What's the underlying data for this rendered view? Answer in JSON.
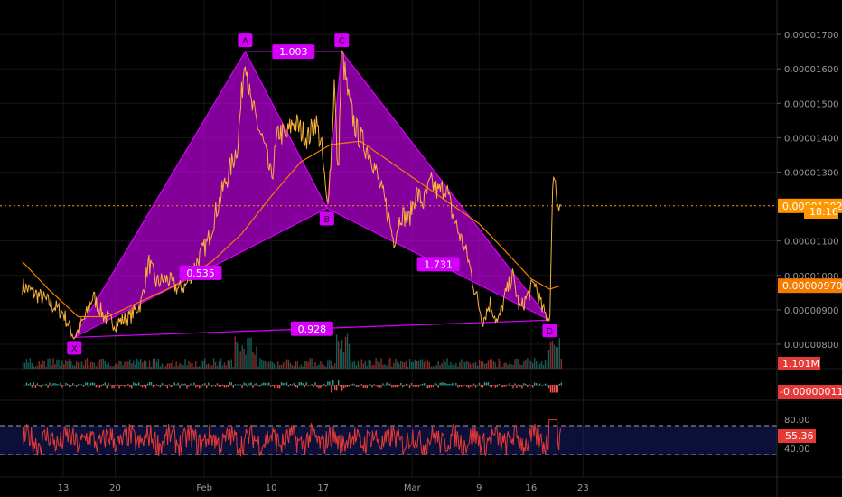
{
  "chart_data": {
    "type": "line",
    "title": "",
    "price_axis": {
      "ylim": [
        7.5e-06,
        1.8e-05
      ],
      "ticks": [
        "0.00001700",
        "0.00001600",
        "0.00001500",
        "0.00001400",
        "0.00001300",
        "0.00001100",
        "0.00001000",
        "0.00000900",
        "0.00000800"
      ],
      "tick_values": [
        1.7e-05,
        1.6e-05,
        1.5e-05,
        1.4e-05,
        1.3e-05,
        1.1e-05,
        1e-05,
        9e-06,
        8e-06
      ]
    },
    "date_axis": {
      "labels": [
        "13",
        "20",
        "Feb",
        "10",
        "17",
        "Mar",
        "9",
        "16",
        "23"
      ],
      "day_index": [
        0,
        7,
        19,
        28,
        35,
        47,
        56,
        63,
        70
      ]
    },
    "current_price": {
      "value": "0.00001202",
      "countdown": "18:16",
      "color": "#ff9800"
    },
    "moving_average": {
      "value": "0.00000970",
      "color": "#f57c00"
    },
    "volume": {
      "value": "1.101M",
      "color": "#e53935"
    },
    "macd": {
      "value": "-0.00000011",
      "color": "#e53935"
    },
    "rsi": {
      "value": "55.36",
      "upper": "80.00",
      "lower": "40.00",
      "upper_value": 70,
      "lower_value": 30,
      "color": "#e53935"
    },
    "harmonic_pattern": {
      "color": "#d500f9",
      "points": [
        {
          "name": "X",
          "day": 1.5,
          "price": 8.2e-06
        },
        {
          "name": "A",
          "day": 24.5,
          "price": 1.65e-05
        },
        {
          "name": "B",
          "day": 35.5,
          "price": 1.195e-05
        },
        {
          "name": "C",
          "day": 37.5,
          "price": 1.65e-05
        },
        {
          "name": "D",
          "day": 65.5,
          "price": 8.7e-06
        }
      ],
      "ratios": [
        {
          "label": "0.535",
          "between": "XB"
        },
        {
          "label": "1.003",
          "between": "AC"
        },
        {
          "label": "1.731",
          "between": "BD"
        },
        {
          "label": "0.928",
          "between": "XD"
        }
      ]
    },
    "price_series": {
      "color": "#f6b23b",
      "keypoints": [
        [
          -5.5,
          9.7e-06
        ],
        [
          -2.5,
          9.3e-06
        ],
        [
          0.0,
          8.9e-06
        ],
        [
          1.5,
          8.2e-06
        ],
        [
          3.0,
          8.8e-06
        ],
        [
          4.0,
          9.4e-06
        ],
        [
          5.5,
          8.8e-06
        ],
        [
          7.0,
          8.6e-06
        ],
        [
          9.0,
          8.8e-06
        ],
        [
          10.5,
          9.2e-06
        ],
        [
          11.5,
          1.04e-05
        ],
        [
          12.5,
          9.8e-06
        ],
        [
          14.0,
          9.9e-06
        ],
        [
          15.5,
          9.6e-06
        ],
        [
          16.5,
          9.7e-06
        ],
        [
          18.0,
          1.04e-05
        ],
        [
          19.5,
          1.1e-05
        ],
        [
          20.5,
          1.18e-05
        ],
        [
          21.5,
          1.25e-05
        ],
        [
          22.5,
          1.31e-05
        ],
        [
          23.5,
          1.38e-05
        ],
        [
          24.5,
          1.65e-05
        ],
        [
          25.2,
          1.5e-05
        ],
        [
          26.0,
          1.45e-05
        ],
        [
          27.0,
          1.38e-05
        ],
        [
          28.0,
          1.28e-05
        ],
        [
          29.0,
          1.42e-05
        ],
        [
          30.0,
          1.4e-05
        ],
        [
          31.0,
          1.45e-05
        ],
        [
          32.0,
          1.42e-05
        ],
        [
          33.0,
          1.4e-05
        ],
        [
          34.0,
          1.45e-05
        ],
        [
          34.8,
          1.37e-05
        ],
        [
          35.5,
          1.2e-05
        ],
        [
          36.0,
          1.32e-05
        ],
        [
          36.5,
          1.56e-05
        ],
        [
          37.0,
          1.28e-05
        ],
        [
          37.5,
          1.65e-05
        ],
        [
          38.5,
          1.5e-05
        ],
        [
          39.5,
          1.42e-05
        ],
        [
          40.5,
          1.38e-05
        ],
        [
          41.5,
          1.35e-05
        ],
        [
          42.5,
          1.27e-05
        ],
        [
          43.5,
          1.2e-05
        ],
        [
          44.5,
          1.1e-05
        ],
        [
          45.5,
          1.18e-05
        ],
        [
          46.5,
          1.16e-05
        ],
        [
          47.5,
          1.24e-05
        ],
        [
          48.5,
          1.21e-05
        ],
        [
          49.5,
          1.27e-05
        ],
        [
          50.5,
          1.24e-05
        ],
        [
          51.5,
          1.26e-05
        ],
        [
          52.5,
          1.17e-05
        ],
        [
          53.5,
          1.11e-05
        ],
        [
          54.5,
          1.05e-05
        ],
        [
          55.5,
          9.5e-06
        ],
        [
          56.5,
          8.7e-06
        ],
        [
          57.5,
          9.2e-06
        ],
        [
          58.5,
          8.6e-06
        ],
        [
          59.5,
          9.4e-06
        ],
        [
          60.5,
          1e-05
        ],
        [
          61.5,
          9e-06
        ],
        [
          62.5,
          9.4e-06
        ],
        [
          63.5,
          9.8e-06
        ],
        [
          64.5,
          9e-06
        ],
        [
          65.5,
          8.7e-06
        ],
        [
          66.0,
          1.32e-05
        ],
        [
          66.5,
          1.22e-05
        ],
        [
          67.0,
          1.21e-05
        ]
      ]
    },
    "ma_series": {
      "keypoints": [
        [
          -5.5,
          1.04e-05
        ],
        [
          -2.0,
          9.6e-06
        ],
        [
          2.0,
          8.8e-06
        ],
        [
          6.0,
          8.8e-06
        ],
        [
          10.0,
          9.2e-06
        ],
        [
          15.0,
          9.7e-06
        ],
        [
          20.0,
          1.04e-05
        ],
        [
          24.0,
          1.12e-05
        ],
        [
          28.0,
          1.23e-05
        ],
        [
          32.0,
          1.33e-05
        ],
        [
          36.0,
          1.38e-05
        ],
        [
          40.0,
          1.39e-05
        ],
        [
          44.0,
          1.33e-05
        ],
        [
          48.0,
          1.27e-05
        ],
        [
          52.0,
          1.21e-05
        ],
        [
          56.0,
          1.15e-05
        ],
        [
          60.0,
          1.06e-05
        ],
        [
          63.0,
          9.9e-06
        ],
        [
          65.5,
          9.6e-06
        ],
        [
          67.0,
          9.7e-06
        ]
      ]
    }
  }
}
